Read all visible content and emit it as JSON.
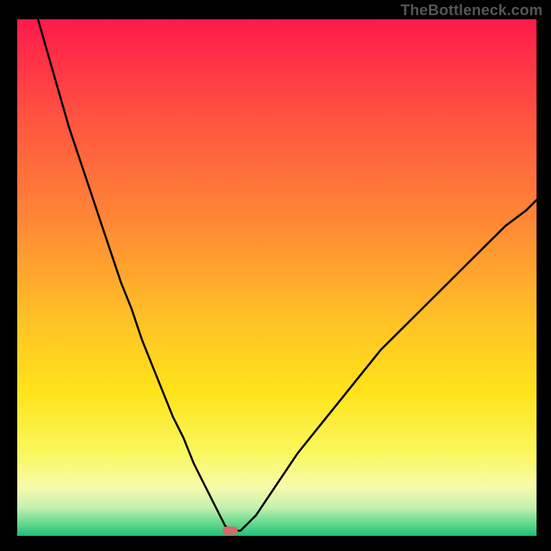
{
  "watermark": "TheBottleneck.com",
  "chart_data": {
    "type": "line",
    "title": "",
    "xlabel": "",
    "ylabel": "",
    "xlim": [
      0,
      100
    ],
    "ylim": [
      0,
      100
    ],
    "grid": false,
    "marker": {
      "x": 41,
      "y": 1,
      "color": "#d46a6a"
    },
    "background_gradient": {
      "stops": [
        {
          "offset": 0.0,
          "color": "#ff1a4b"
        },
        {
          "offset": 0.2,
          "color": "#ff5640"
        },
        {
          "offset": 0.4,
          "color": "#ff8a35"
        },
        {
          "offset": 0.58,
          "color": "#ffc126"
        },
        {
          "offset": 0.72,
          "color": "#ffe31a"
        },
        {
          "offset": 0.84,
          "color": "#faf75e"
        },
        {
          "offset": 0.905,
          "color": "#f7fbaa"
        },
        {
          "offset": 0.945,
          "color": "#c6f0b0"
        },
        {
          "offset": 0.975,
          "color": "#66d98f"
        },
        {
          "offset": 1.0,
          "color": "#1fc176"
        }
      ]
    },
    "series": [
      {
        "name": "bottleneck-curve",
        "color": "#000000",
        "x": [
          4,
          6,
          8,
          10,
          12,
          14,
          16,
          18,
          20,
          22,
          24,
          26,
          28,
          30,
          32,
          34,
          36,
          37,
          38,
          39,
          40,
          41,
          42,
          43,
          44,
          46,
          48,
          50,
          54,
          58,
          62,
          66,
          70,
          74,
          78,
          82,
          86,
          90,
          94,
          98,
          100
        ],
        "y": [
          100,
          93,
          86,
          79,
          73,
          67,
          61,
          55,
          49,
          44,
          38,
          33,
          28,
          23,
          19,
          14,
          10,
          8,
          6,
          4,
          2,
          1,
          1,
          1,
          2,
          4,
          7,
          10,
          16,
          21,
          26,
          31,
          36,
          40,
          44,
          48,
          52,
          56,
          60,
          63,
          65
        ]
      }
    ]
  }
}
